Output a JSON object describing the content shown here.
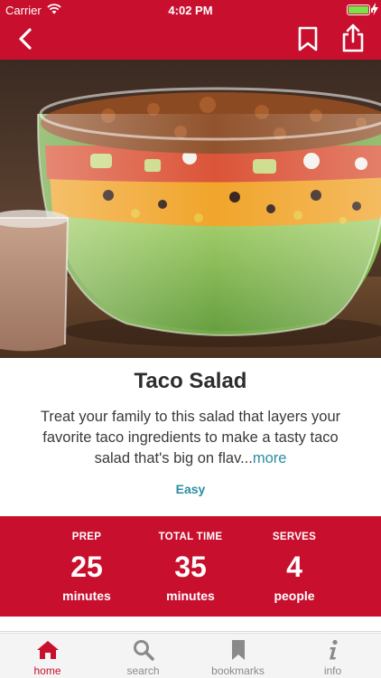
{
  "status_bar": {
    "carrier": "Carrier",
    "time": "4:02 PM"
  },
  "nav": {
    "back_icon": "chevron-left-icon",
    "bookmark_icon": "bookmark-icon",
    "share_icon": "share-icon"
  },
  "colors": {
    "brand_red": "#c8102e",
    "link_teal": "#2a8ea0"
  },
  "recipe": {
    "title": "Taco Salad",
    "description": "Treat your family to this salad that layers your favorite taco ingredients to make a tasty taco salad that's big on flav...",
    "more_label": "more",
    "difficulty": "Easy"
  },
  "stats": {
    "prep": {
      "label": "PREP",
      "value": "25",
      "unit": "minutes"
    },
    "total": {
      "label": "TOTAL TIME",
      "value": "35",
      "unit": "minutes"
    },
    "serves": {
      "label": "SERVES",
      "value": "4",
      "unit": "people"
    }
  },
  "tabs": [
    {
      "label": "home",
      "icon": "home-icon",
      "active": true
    },
    {
      "label": "search",
      "icon": "search-icon",
      "active": false
    },
    {
      "label": "bookmarks",
      "icon": "bookmark-icon",
      "active": false
    },
    {
      "label": "info",
      "icon": "info-icon",
      "active": false
    }
  ]
}
